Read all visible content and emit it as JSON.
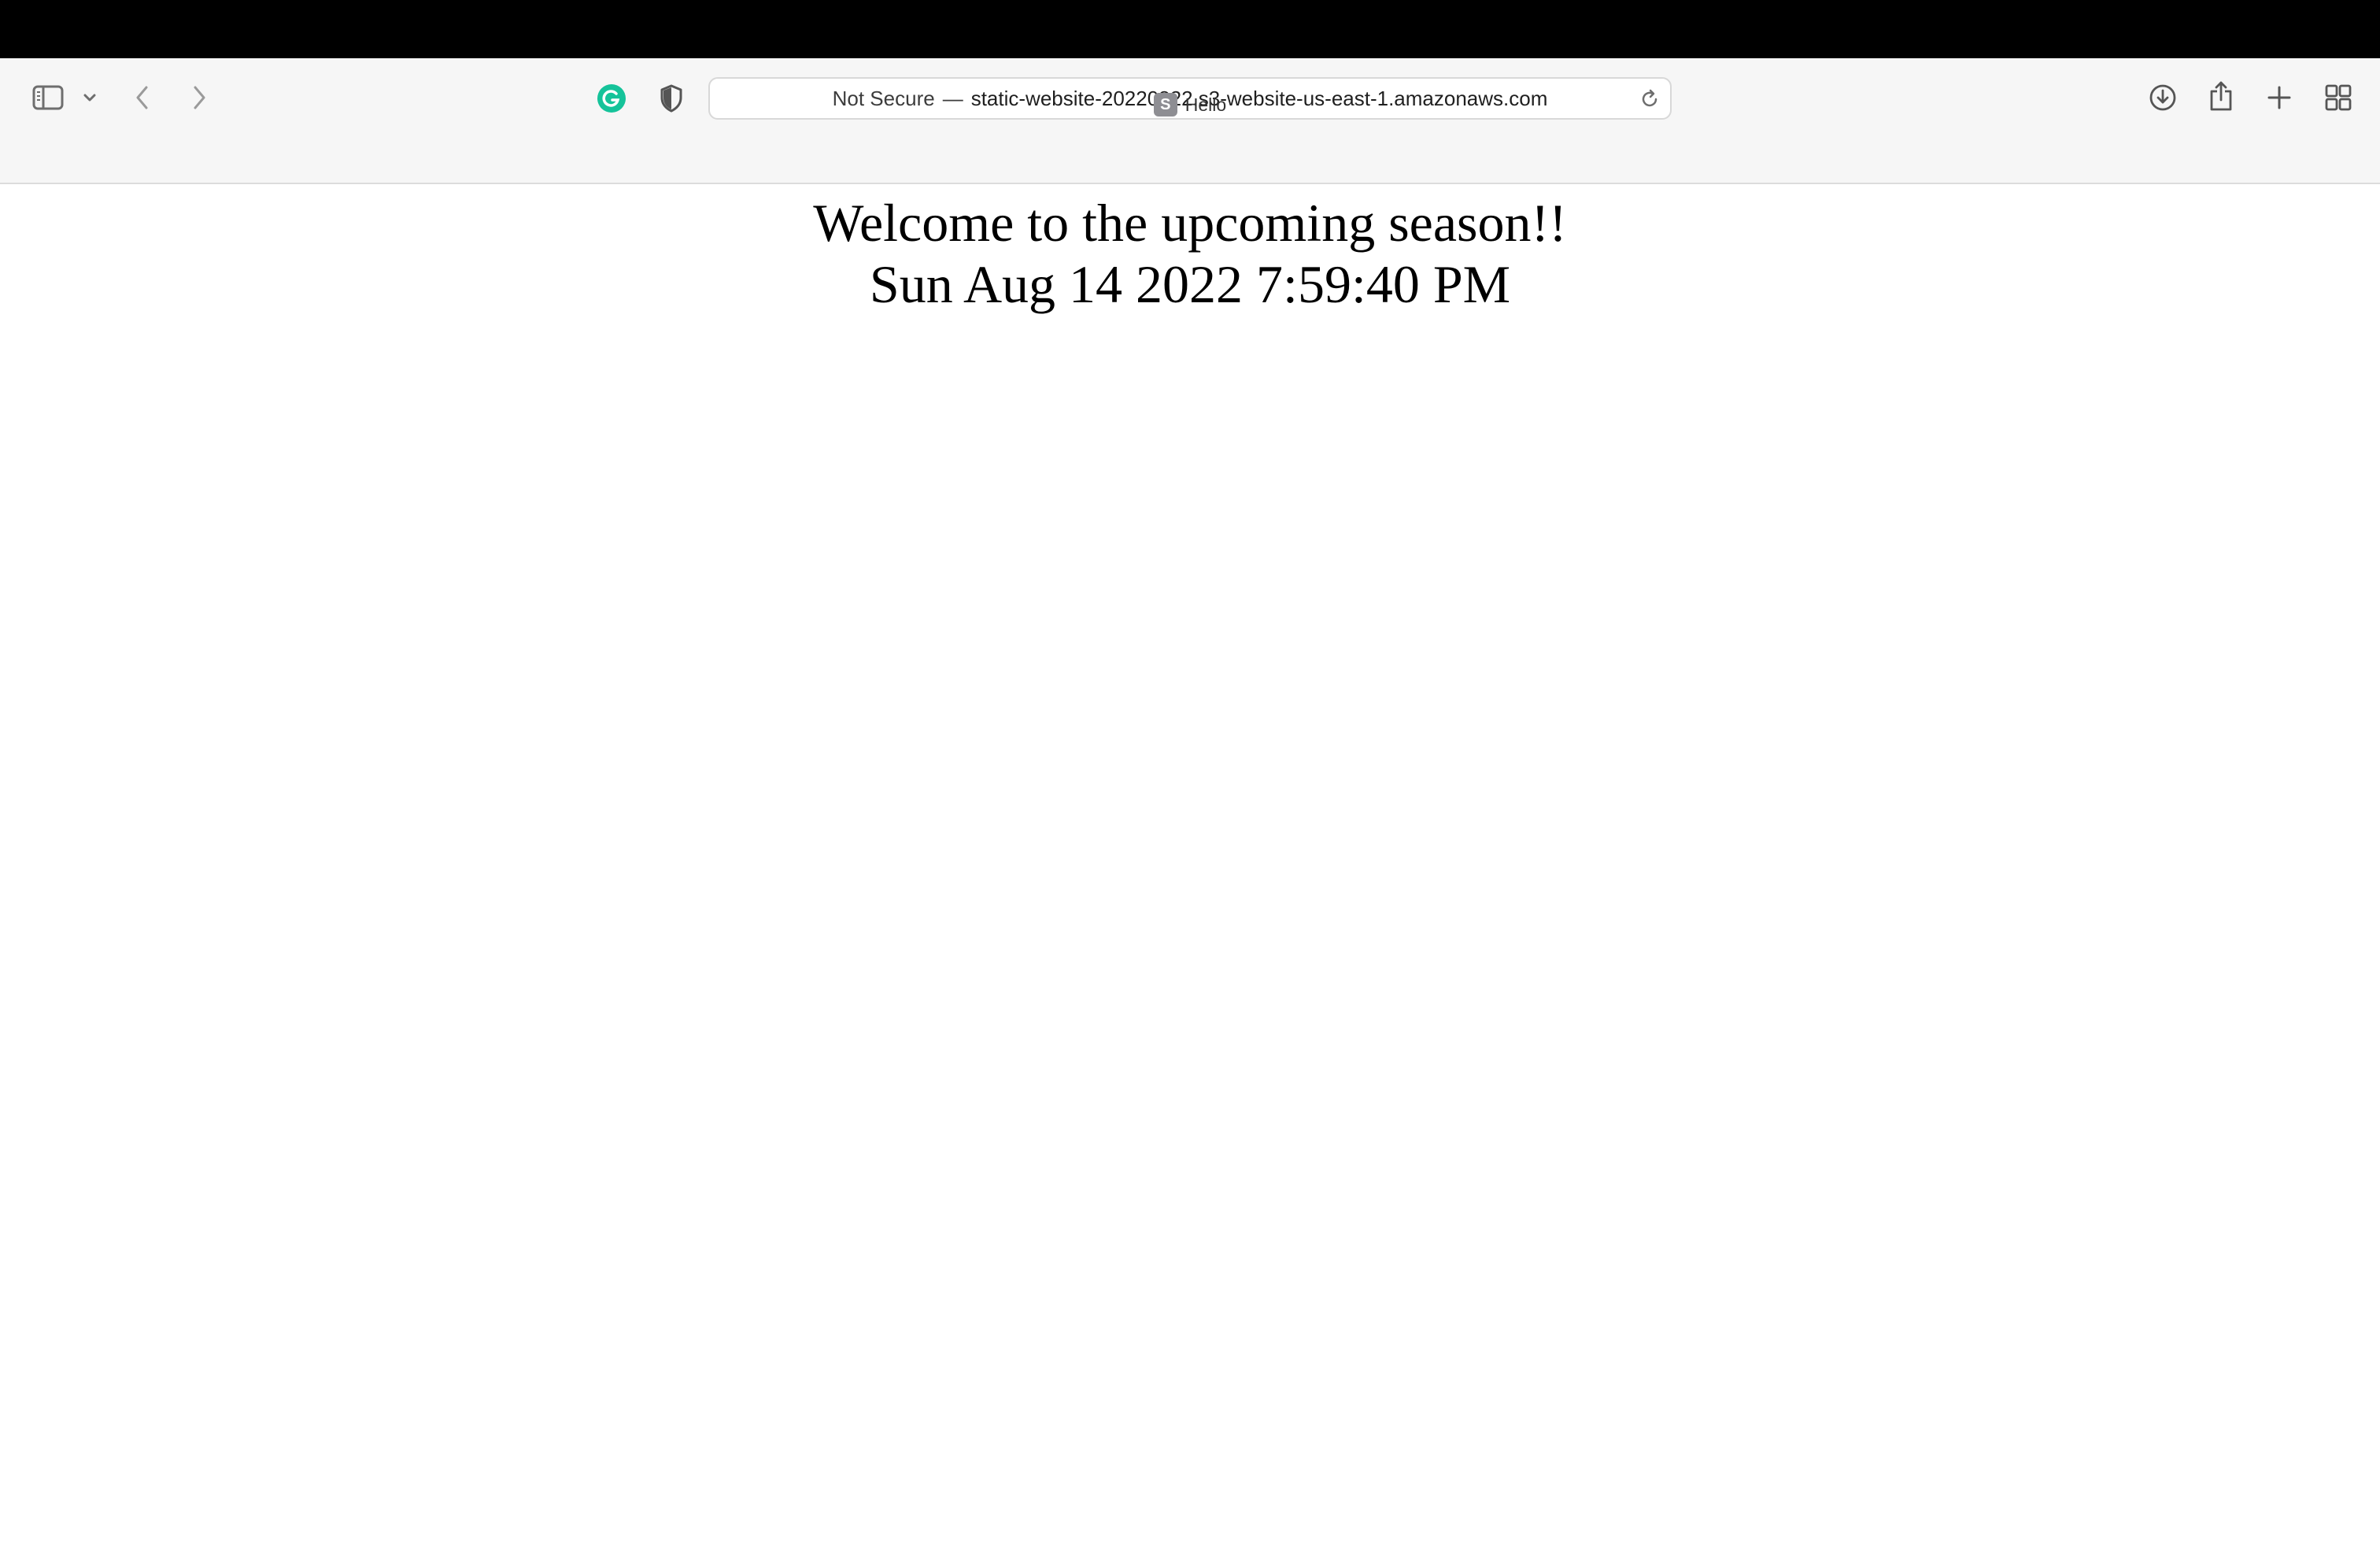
{
  "browser": {
    "address_bar": {
      "security_label": "Not Secure",
      "separator": "—",
      "url": "static-website-20220822.s3-website-us-east-1.amazonaws.com"
    },
    "tab": {
      "favicon_letter": "S",
      "title": "Hello"
    },
    "extension_badge": "G",
    "colors": {
      "grammarly_green": "#15c39a",
      "toolbar_bg": "#f6f6f6",
      "menubar_bg": "#000000"
    },
    "icons": {
      "sidebar": "sidebar-icon",
      "sidebar_menu": "chevron-down-icon",
      "back": "chevron-left-icon",
      "forward": "chevron-right-icon",
      "grammarly": "grammarly-icon",
      "privacy": "shield-icon",
      "reload": "reload-icon",
      "downloads": "download-icon",
      "share": "share-icon",
      "new_tab": "plus-icon",
      "tab_overview": "grid-icon"
    }
  },
  "page": {
    "heading": "Welcome to the upcoming season!!",
    "datetime": "Sun Aug 14 2022 7:59:40 PM"
  }
}
